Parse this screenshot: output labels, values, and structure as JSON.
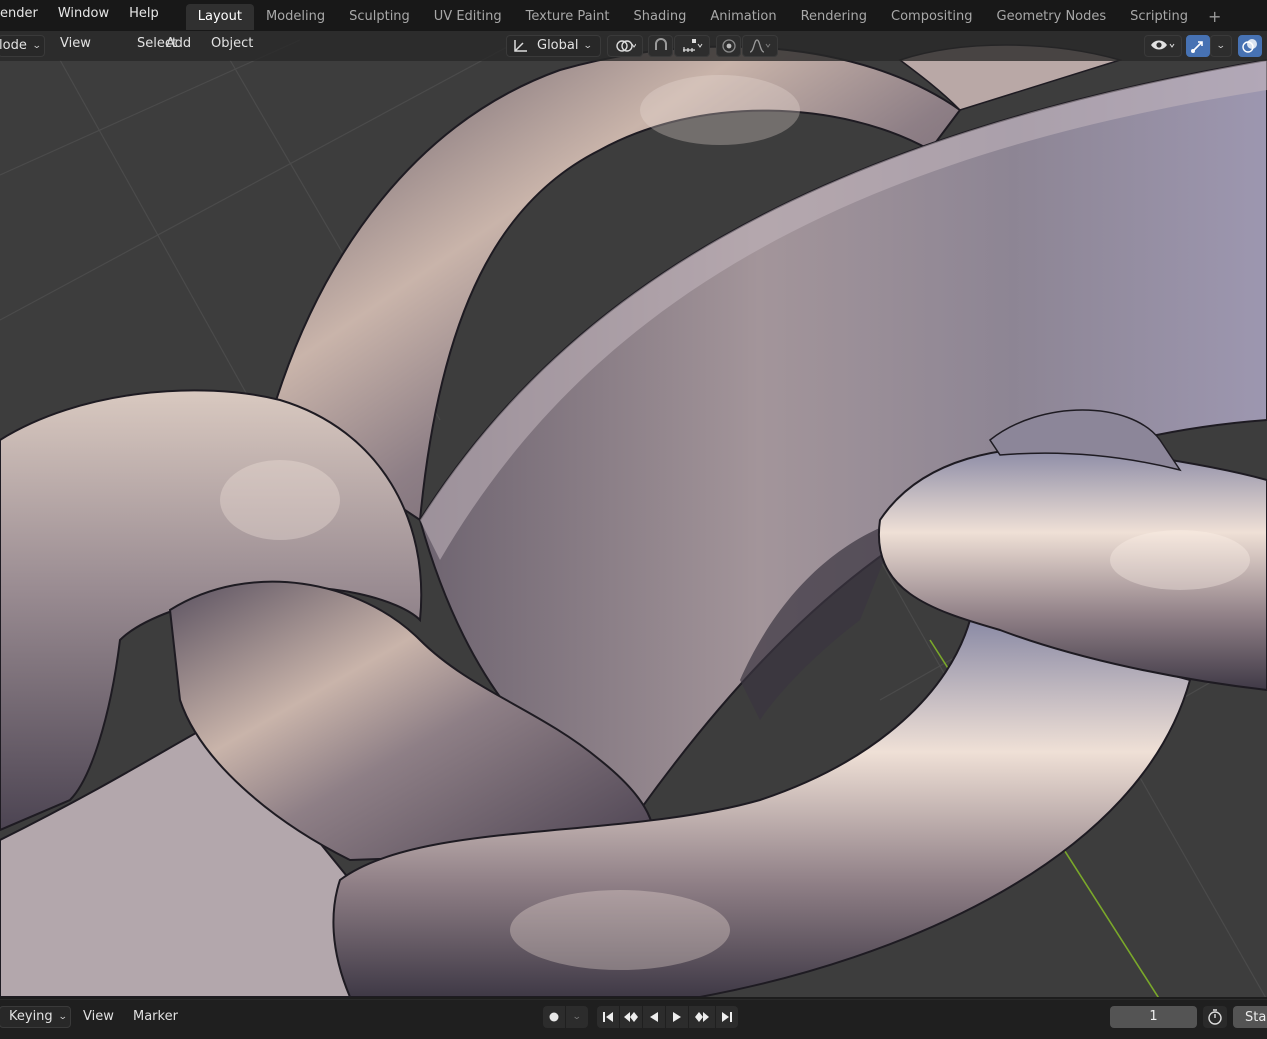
{
  "topbar": {
    "menus": [
      "ender",
      "Window",
      "Help"
    ],
    "workspaces": [
      "Layout",
      "Modeling",
      "Sculpting",
      "UV Editing",
      "Texture Paint",
      "Shading",
      "Animation",
      "Rendering",
      "Compositing",
      "Geometry Nodes",
      "Scripting"
    ],
    "active_workspace": "Layout",
    "add_workspace_icon": "plus-icon"
  },
  "viewport_header": {
    "mode_label": "lode",
    "menus": [
      "View",
      "Select",
      "Add",
      "Object"
    ],
    "orientation_label": "Global",
    "icons": [
      "transform-orientation-icon",
      "pivot-point-icon",
      "snap-icon",
      "snap-increment-icon",
      "proportional-edit-icon",
      "falloff-curve-icon",
      "visibility-eye-icon",
      "gizmo-icon",
      "overlay-icon"
    ]
  },
  "timeline": {
    "keying_label": "Keying",
    "view_label": "View",
    "marker_label": "Marker",
    "current_frame": "1",
    "start_label": "Sta",
    "icons": [
      "record-icon",
      "jump-start-icon",
      "prev-keyframe-icon",
      "play-reverse-icon",
      "play-icon",
      "next-keyframe-icon",
      "jump-end-icon",
      "clock-icon"
    ]
  },
  "colors": {
    "viewport_bg": "#3d3d3d",
    "grid_line": "#4a4a4a",
    "y_axis": "#8ab82e",
    "active_tab": "#303030",
    "accent_blue": "#4772b3",
    "metal_light": "#c9b6ae",
    "metal_dark": "#4a4150"
  }
}
